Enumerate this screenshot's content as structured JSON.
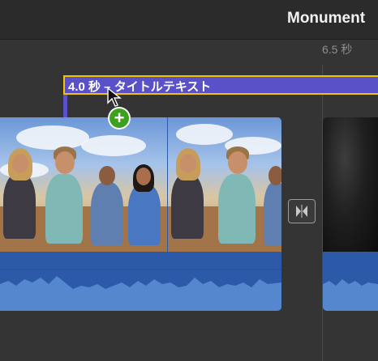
{
  "header": {
    "project_title": "Monument"
  },
  "timeline": {
    "timecode": "6.5 秒"
  },
  "title_clip": {
    "label": "4.0 秒 – タイトルテキスト",
    "color": "#5a50c8",
    "selection_color": "#f0c500"
  },
  "cursor": {
    "icon": "pointer-cursor-icon",
    "badge_icon": "plus-icon",
    "badge_symbol": "+"
  },
  "transition": {
    "icon": "transition-icon"
  },
  "clips": [
    {
      "name": "video-clip-friends",
      "audio_color": "#2c5aa8"
    },
    {
      "name": "video-clip-dark"
    }
  ]
}
